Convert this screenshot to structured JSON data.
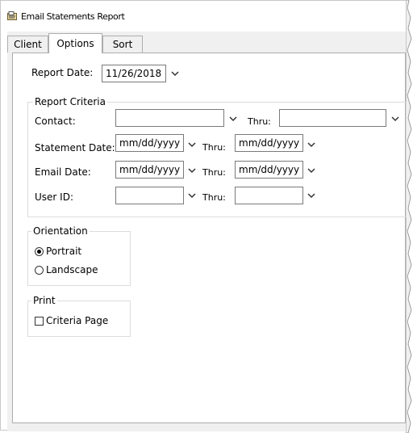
{
  "window": {
    "title": "Email Statements Report"
  },
  "tabs": [
    {
      "label": "Client"
    },
    {
      "label": "Options"
    },
    {
      "label": "Sort"
    }
  ],
  "report_date": {
    "label": "Report Date:",
    "value": "11/26/2018"
  },
  "criteria": {
    "legend": "Report Criteria",
    "thru_label": "Thru:",
    "rows": [
      {
        "label": "Contact:",
        "from": "",
        "to": ""
      },
      {
        "label": "Statement Date:",
        "from": "mm/dd/yyyy",
        "to": "mm/dd/yyyy"
      },
      {
        "label": "Email Date:",
        "from": "mm/dd/yyyy",
        "to": "mm/dd/yyyy"
      },
      {
        "label": "User ID:",
        "from": "",
        "to": ""
      }
    ]
  },
  "orientation": {
    "legend": "Orientation",
    "options": [
      {
        "label": "Portrait",
        "selected": true
      },
      {
        "label": "Landscape",
        "selected": false
      }
    ]
  },
  "print": {
    "legend": "Print",
    "criteria_page": {
      "label": "Criteria Page",
      "checked": false
    }
  },
  "colors": {
    "panel_bg": "#ffffff",
    "client_bg": "#f0f0f0",
    "border": "#adadad"
  },
  "icons": {
    "app": "report-icon",
    "dropdown": "chevron-down-icon"
  }
}
